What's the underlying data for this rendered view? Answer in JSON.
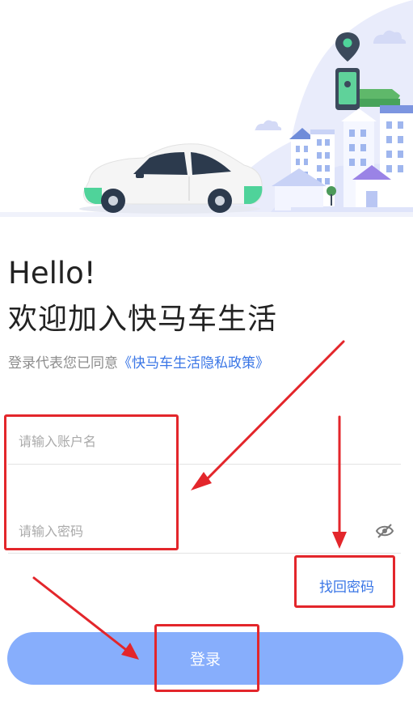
{
  "greeting": {
    "hello": "Hello!",
    "welcome": "欢迎加入快马车生活"
  },
  "consent": {
    "prefix": "登录代表您已同意",
    "policy_link": "《快马车生活隐私政策》"
  },
  "form": {
    "username_placeholder": "请输入账户名",
    "password_placeholder": "请输入密码",
    "password_toggle_icon": "eye-off-icon"
  },
  "forgot_password": "找回密码",
  "login_button": "登录",
  "colors": {
    "accent_blue": "#3a76e6",
    "button_blue": "#87aefc",
    "highlight_red": "#e3262b"
  }
}
